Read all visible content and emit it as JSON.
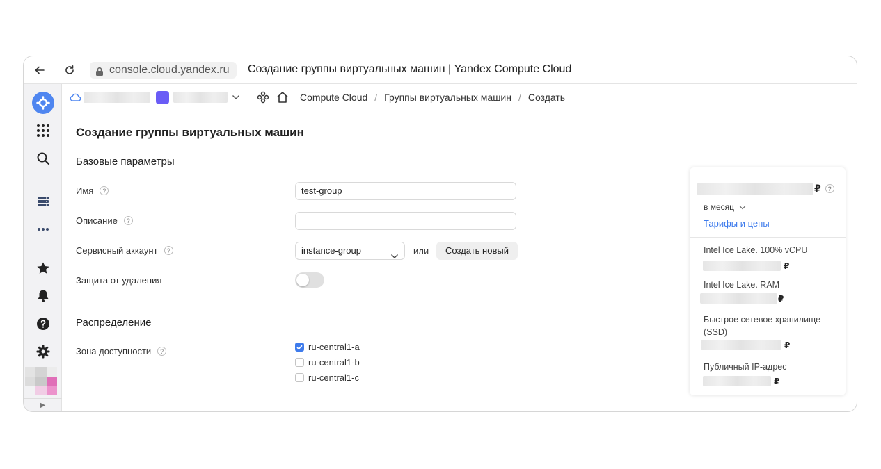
{
  "browser": {
    "url": "console.cloud.yandex.ru",
    "tab_title": "Создание группы виртуальных машин | Yandex Compute Cloud"
  },
  "breadcrumbs": {
    "service": "Compute Cloud",
    "section": "Группы виртуальных машин",
    "current": "Создать",
    "separator": "/"
  },
  "page": {
    "title": "Создание группы виртуальных машин",
    "basic_section": "Базовые параметры",
    "distribution_section": "Распределение"
  },
  "form": {
    "help_glyph": "?",
    "name_label": "Имя",
    "name_value": "test-group",
    "description_label": "Описание",
    "description_value": "",
    "service_account_label": "Сервисный аккаунт",
    "service_account_value": "instance-group",
    "or_text": "или",
    "create_new_label": "Создать новый",
    "deletion_protection_label": "Защита от удаления",
    "deletion_protection_on": false,
    "zone_label": "Зона доступности",
    "zones": [
      {
        "label": "ru-central1-a",
        "checked": true
      },
      {
        "label": "ru-central1-b",
        "checked": false
      },
      {
        "label": "ru-central1-c",
        "checked": false
      }
    ]
  },
  "price_panel": {
    "currency": "₽",
    "period": "в месяц",
    "tariffs_link": "Тарифы и цены",
    "items": [
      {
        "label": "Intel Ice Lake. 100% vCPU"
      },
      {
        "label": "Intel Ice Lake. RAM"
      },
      {
        "label": "Быстрое сетевое хранилище (SSD)"
      },
      {
        "label": "Публичный IP-адрес"
      }
    ]
  },
  "sidebar": {
    "expand_glyph": "▶"
  },
  "colors": {
    "accent": "#3e7bec",
    "folder": "#6a5cf6",
    "sidebar_bg": "#f2f2f4"
  }
}
